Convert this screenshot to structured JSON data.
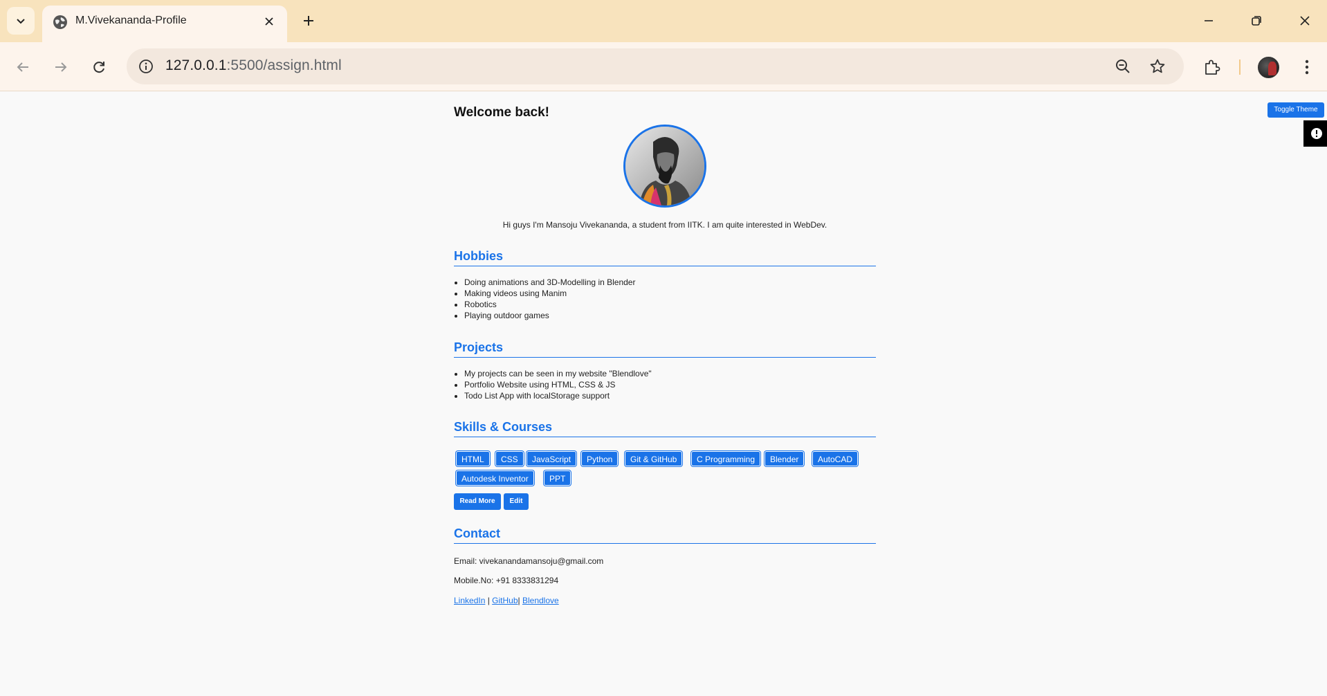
{
  "browser": {
    "tab_title": "M.Vivekananda-Profile",
    "url_host": "127.0.0.1",
    "url_rest": ":5500/assign.html"
  },
  "page": {
    "welcome": "Welcome back!",
    "intro": "Hi guys I'm Mansoju Vivekananda, a student from IITK. I am quite interested in WebDev.",
    "toggle_theme": "Toggle Theme",
    "hobbies": {
      "title": "Hobbies",
      "items": [
        "Doing animations and 3D-Modelling in Blender",
        "Making videos using Manim",
        "Robotics",
        "Playing outdoor games"
      ]
    },
    "projects": {
      "title": "Projects",
      "items": [
        "My projects can be seen in my website \"Blendlove\"",
        "Portfolio Website using HTML, CSS & JS",
        "Todo List App with localStorage support"
      ]
    },
    "skills": {
      "title": "Skills & Courses",
      "items": [
        "HTML",
        "CSS",
        "JavaScript",
        "Python",
        "Git & GitHub",
        "C Programming",
        "Blender",
        "AutoCAD",
        "Autodesk Inventor",
        "PPT"
      ]
    },
    "buttons": {
      "read_more": "Read More",
      "edit": "Edit"
    },
    "contact": {
      "title": "Contact",
      "email": "Email: vivekanandamansoju@gmail.com",
      "mobile": "Mobile.No: +91 8333831294",
      "links": [
        "LinkedIn",
        "GitHub",
        "Blendlove"
      ],
      "sep1": " | ",
      "sep2": "| "
    }
  },
  "colors": {
    "accent": "#1a73e8",
    "tabstrip": "#f8e3bd",
    "toolbar": "#fdf4ec"
  }
}
